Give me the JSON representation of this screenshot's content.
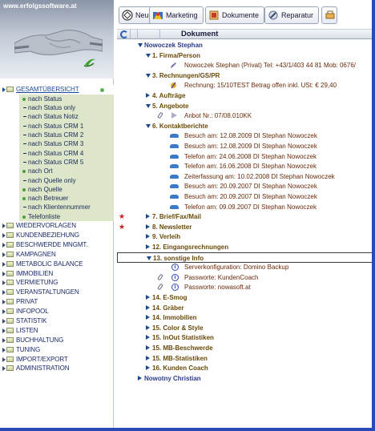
{
  "logo": {
    "url": "www.erfolgssoftware.at"
  },
  "toolbar": {
    "buttons": [
      {
        "label": "Neu",
        "icon": "new-icon"
      },
      {
        "label": "Marketing",
        "icon": "marketing-icon"
      },
      {
        "label": "Dokumente",
        "icon": "documents-icon"
      },
      {
        "label": "Reparatur",
        "icon": "repair-icon"
      }
    ]
  },
  "grid": {
    "column_title": "Dokument"
  },
  "nav": {
    "overview_label": "GESAMTÜBERSICHT",
    "sub_items": [
      {
        "label": "nach Status",
        "style": "bullet"
      },
      {
        "label": "nach Status only",
        "style": "dash"
      },
      {
        "label": "nach Status Notiz",
        "style": "dash"
      },
      {
        "label": "nach Status CRM 1",
        "style": "dash"
      },
      {
        "label": "nach Status CRM 2",
        "style": "dash"
      },
      {
        "label": "nach Status CRM 3",
        "style": "dash"
      },
      {
        "label": "nach Status CRM 4",
        "style": "dash"
      },
      {
        "label": "nach Status CRM 5",
        "style": "dash"
      },
      {
        "label": "nach Ort",
        "style": "bullet"
      },
      {
        "label": "nach Quelle only",
        "style": "dash"
      },
      {
        "label": "nach Quelle",
        "style": "bullet"
      },
      {
        "label": "nach Betreuer",
        "style": "bullet"
      },
      {
        "label": "nach Klientennummer",
        "style": "dash"
      },
      {
        "label": "Telefonliste",
        "style": "bullet"
      }
    ],
    "items": [
      "WIEDERVORLAGEN",
      "KUNDENBEZIEHUNG",
      "BESCHWERDE Mngmt.",
      "KAMPAGNEN",
      "METABOLIC BALANCE",
      "IMMOBILIEN",
      "VERMIETUNG",
      "VERANSTALTUNGEN",
      "PRIVAT",
      "INFOPOOL",
      "STATISTIK",
      "LISTEN",
      "BUCHHALTUNG",
      "TUNING",
      "IMPORT/EXPORT",
      "ADMINISTRATION"
    ]
  },
  "tree": {
    "root": "Nowoczek Stephan",
    "rows": [
      {
        "kind": "sect",
        "open": true,
        "text": "1. Firma/Person"
      },
      {
        "kind": "leaf",
        "icon": "pen-icon",
        "text": "Nowoczek Stephan (Privat) Tel: +43/1/403 44 81 Mob: 0676/"
      },
      {
        "kind": "sect",
        "open": true,
        "text": "3. Rechnungen/GS/PR"
      },
      {
        "kind": "leaf",
        "icon": "money-icon",
        "text": "Rechnung: 15/10TEST  Betrag offen inkl. USt:  € 29,40"
      },
      {
        "kind": "sect",
        "open": false,
        "text": "4. Aufträge"
      },
      {
        "kind": "sect",
        "open": true,
        "text": "5. Angebote"
      },
      {
        "kind": "leaf",
        "icon": "flag-icon",
        "clip": true,
        "text": "Anbot Nr.: 07/08.010KK"
      },
      {
        "kind": "sect",
        "open": true,
        "text": "6. Kontaktberichte"
      },
      {
        "kind": "leaf",
        "icon": "car-icon",
        "text": "Besuch am: 12.08.2009  DI Stephan Nowoczek"
      },
      {
        "kind": "leaf",
        "icon": "car-icon",
        "text": "Besuch am: 12.08.2009  DI Stephan Nowoczek"
      },
      {
        "kind": "leaf",
        "icon": "car-icon",
        "text": "Telefon am: 24.06.2008  DI Stephan Nowoczek"
      },
      {
        "kind": "leaf",
        "icon": "car-icon",
        "text": "Telefon am: 16.06.2008  DI Stephan Nowoczek"
      },
      {
        "kind": "leaf",
        "icon": "car-icon",
        "text": "Zeiterfassung am: 10.02.2008  DI Stephan Nowoczek"
      },
      {
        "kind": "leaf",
        "icon": "car-icon",
        "text": "Besuch am: 20.09.2007  DI Stephan Nowoczek"
      },
      {
        "kind": "leaf",
        "icon": "car-icon",
        "text": "Besuch am: 20.09.2007  DI Stephan Nowoczek"
      },
      {
        "kind": "leaf",
        "icon": "car-icon",
        "text": "Telefon am: 09.09.2007  DI Stephan Nowoczek"
      },
      {
        "kind": "sect",
        "open": false,
        "text": "7. Brief/Fax/Mail",
        "star": true
      },
      {
        "kind": "sect",
        "open": false,
        "text": "8. Newsletter",
        "star": true
      },
      {
        "kind": "sect",
        "open": false,
        "text": "9. Verleih"
      },
      {
        "kind": "sect",
        "open": false,
        "text": "12. Eingangsrechnungen"
      },
      {
        "kind": "sect",
        "open": true,
        "text": "13. sonstige Info",
        "highlight": true
      },
      {
        "kind": "leaf",
        "icon": "info-icon",
        "text": "Serverkonfiguration: Domino Backup"
      },
      {
        "kind": "leaf",
        "icon": "info-icon",
        "clip": true,
        "text": "Passworte: KundenCoach"
      },
      {
        "kind": "leaf",
        "icon": "info-icon",
        "clip": true,
        "text": "Passworte: nowasoft.at"
      },
      {
        "kind": "sect",
        "open": false,
        "text": "14. E-Smog"
      },
      {
        "kind": "sect",
        "open": false,
        "text": "14. Gräber"
      },
      {
        "kind": "sect",
        "open": false,
        "text": "14. Immobilien"
      },
      {
        "kind": "sect",
        "open": false,
        "text": "15. Color & Style"
      },
      {
        "kind": "sect",
        "open": false,
        "text": "15. InOut Statistiken"
      },
      {
        "kind": "sect",
        "open": false,
        "text": "15. MB-Beschwerde"
      },
      {
        "kind": "sect",
        "open": false,
        "text": "15. MB-Statistiken"
      },
      {
        "kind": "sect",
        "open": false,
        "text": "16. Kunden Coach"
      },
      {
        "kind": "root2",
        "open": false,
        "text": "Nowotny Christian"
      }
    ]
  }
}
